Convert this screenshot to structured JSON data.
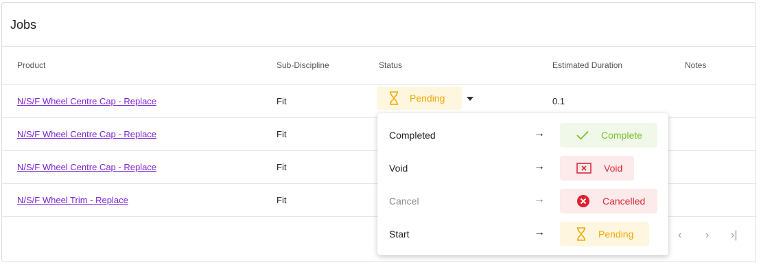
{
  "card": {
    "title": "Jobs"
  },
  "columns": {
    "product": "Product",
    "sub_discipline": "Sub-Discipline",
    "status": "Status",
    "estimated_duration": "Estimated Duration",
    "notes": "Notes"
  },
  "rows": [
    {
      "product": "N/S/F Wheel Centre Cap - Replace",
      "sub_discipline": "Fit",
      "estimated_duration": "0.1"
    },
    {
      "product": "N/S/F Wheel Centre Cap - Replace",
      "sub_discipline": "Fit"
    },
    {
      "product": "N/S/F Wheel Centre Cap - Replace",
      "sub_discipline": "Fit"
    },
    {
      "product": "N/S/F Wheel Trim - Replace",
      "sub_discipline": "Fit"
    }
  ],
  "status_selector": {
    "label": "Pending",
    "icon": "hourglass-icon",
    "color": "#f0a800"
  },
  "dropdown": {
    "items": [
      {
        "action": "Completed",
        "arrow": "→",
        "result": "Complete",
        "icon": "check-icon",
        "color": "#7dbf2b",
        "enabled": true
      },
      {
        "action": "Void",
        "arrow": "→",
        "result": "Void",
        "icon": "void-box-icon",
        "color": "#d82a3c",
        "enabled": true
      },
      {
        "action": "Cancel",
        "arrow": "→",
        "result": "Cancelled",
        "icon": "cancel-circle-icon",
        "color": "#d82a3c",
        "enabled": false
      },
      {
        "action": "Start",
        "arrow": "→",
        "result": "Pending",
        "icon": "hourglass-icon",
        "color": "#f0a800",
        "enabled": true
      }
    ]
  },
  "pagination": {
    "prev": "‹",
    "next": "›",
    "last": "›|"
  }
}
